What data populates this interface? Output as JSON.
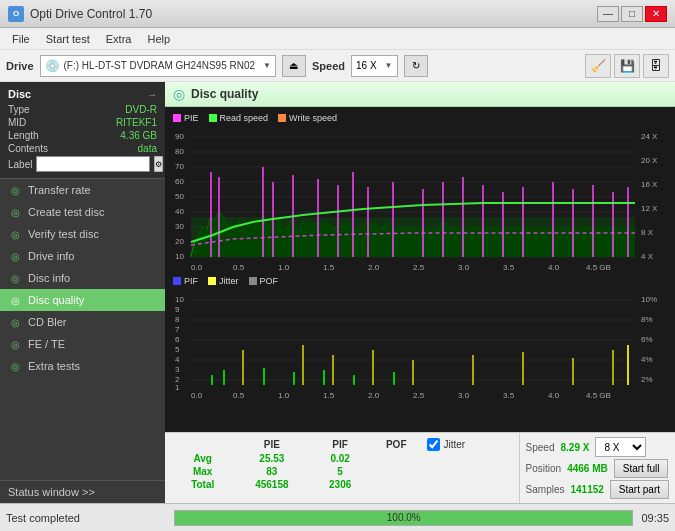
{
  "titlebar": {
    "icon": "O",
    "title": "Opti Drive Control 1.70"
  },
  "menubar": {
    "items": [
      "File",
      "Start test",
      "Extra",
      "Help"
    ]
  },
  "drivebar": {
    "drive_label": "Drive",
    "drive_value": "(F:)  HL-DT-ST DVDRAM GH24NS95 RN02",
    "speed_label": "Speed",
    "speed_value": "16 X"
  },
  "disc": {
    "title": "Disc",
    "type_label": "Type",
    "type_value": "DVD-R",
    "mid_label": "MID",
    "mid_value": "RITEKF1",
    "length_label": "Length",
    "length_value": "4.36 GB",
    "contents_label": "Contents",
    "contents_value": "data",
    "label_label": "Label"
  },
  "nav_items": [
    {
      "id": "transfer-rate",
      "label": "Transfer rate",
      "icon": "◎"
    },
    {
      "id": "create-test-disc",
      "label": "Create test disc",
      "icon": "◎"
    },
    {
      "id": "verify-test-disc",
      "label": "Verify test disc",
      "icon": "◎"
    },
    {
      "id": "drive-info",
      "label": "Drive info",
      "icon": "◎"
    },
    {
      "id": "disc-info",
      "label": "Disc info",
      "icon": "◎"
    },
    {
      "id": "disc-quality",
      "label": "Disc quality",
      "icon": "◎",
      "active": true
    },
    {
      "id": "cd-bler",
      "label": "CD Bler",
      "icon": "◎"
    },
    {
      "id": "fe-te",
      "label": "FE / TE",
      "icon": "◎"
    },
    {
      "id": "extra-tests",
      "label": "Extra tests",
      "icon": "◎"
    }
  ],
  "status_window_label": "Status window >>",
  "disc_quality": {
    "title": "Disc quality",
    "legend": {
      "pie": "PIE",
      "read": "Read speed",
      "write": "Write speed",
      "pif": "PIF",
      "jitter": "Jitter",
      "pof": "POF"
    }
  },
  "stats": {
    "headers": [
      "PIE",
      "PIF",
      "POF",
      "Jitter"
    ],
    "avg_label": "Avg",
    "avg_pie": "25.53",
    "avg_pif": "0.02",
    "max_label": "Max",
    "max_pie": "83",
    "max_pif": "5",
    "total_label": "Total",
    "total_pie": "456158",
    "total_pif": "2306",
    "jitter_checked": true,
    "speed_label": "Speed",
    "speed_value": "8.29 X",
    "position_label": "Position",
    "position_value": "4466 MB",
    "samples_label": "Samples",
    "samples_value": "141152",
    "speed_select": "8 X",
    "btn_start_full": "Start full",
    "btn_start_part": "Start part"
  },
  "statusbar": {
    "status_text": "Test completed",
    "progress_pct": 100,
    "progress_label": "100.0%",
    "time": "09:35"
  },
  "chart_upper": {
    "y_max": 90,
    "y_min": 0,
    "x_max": 4.5,
    "right_labels": [
      "24 X",
      "20 X",
      "16 X",
      "12 X",
      "8 X",
      "4 X"
    ],
    "y_labels": [
      "90",
      "80",
      "70",
      "60",
      "50",
      "40",
      "30",
      "20",
      "10"
    ],
    "x_labels": [
      "0.0",
      "0.5",
      "1.0",
      "1.5",
      "2.0",
      "2.5",
      "3.0",
      "3.5",
      "4.0",
      "4.5 GB"
    ]
  },
  "chart_lower": {
    "y_max": 10,
    "right_labels": [
      "10%",
      "8%",
      "6%",
      "4%",
      "2%"
    ],
    "y_labels": [
      "10",
      "9",
      "8",
      "7",
      "6",
      "5",
      "4",
      "3",
      "2",
      "1"
    ],
    "x_labels": [
      "0.0",
      "0.5",
      "1.0",
      "1.5",
      "2.0",
      "2.5",
      "3.0",
      "3.5",
      "4.0",
      "4.5 GB"
    ]
  }
}
